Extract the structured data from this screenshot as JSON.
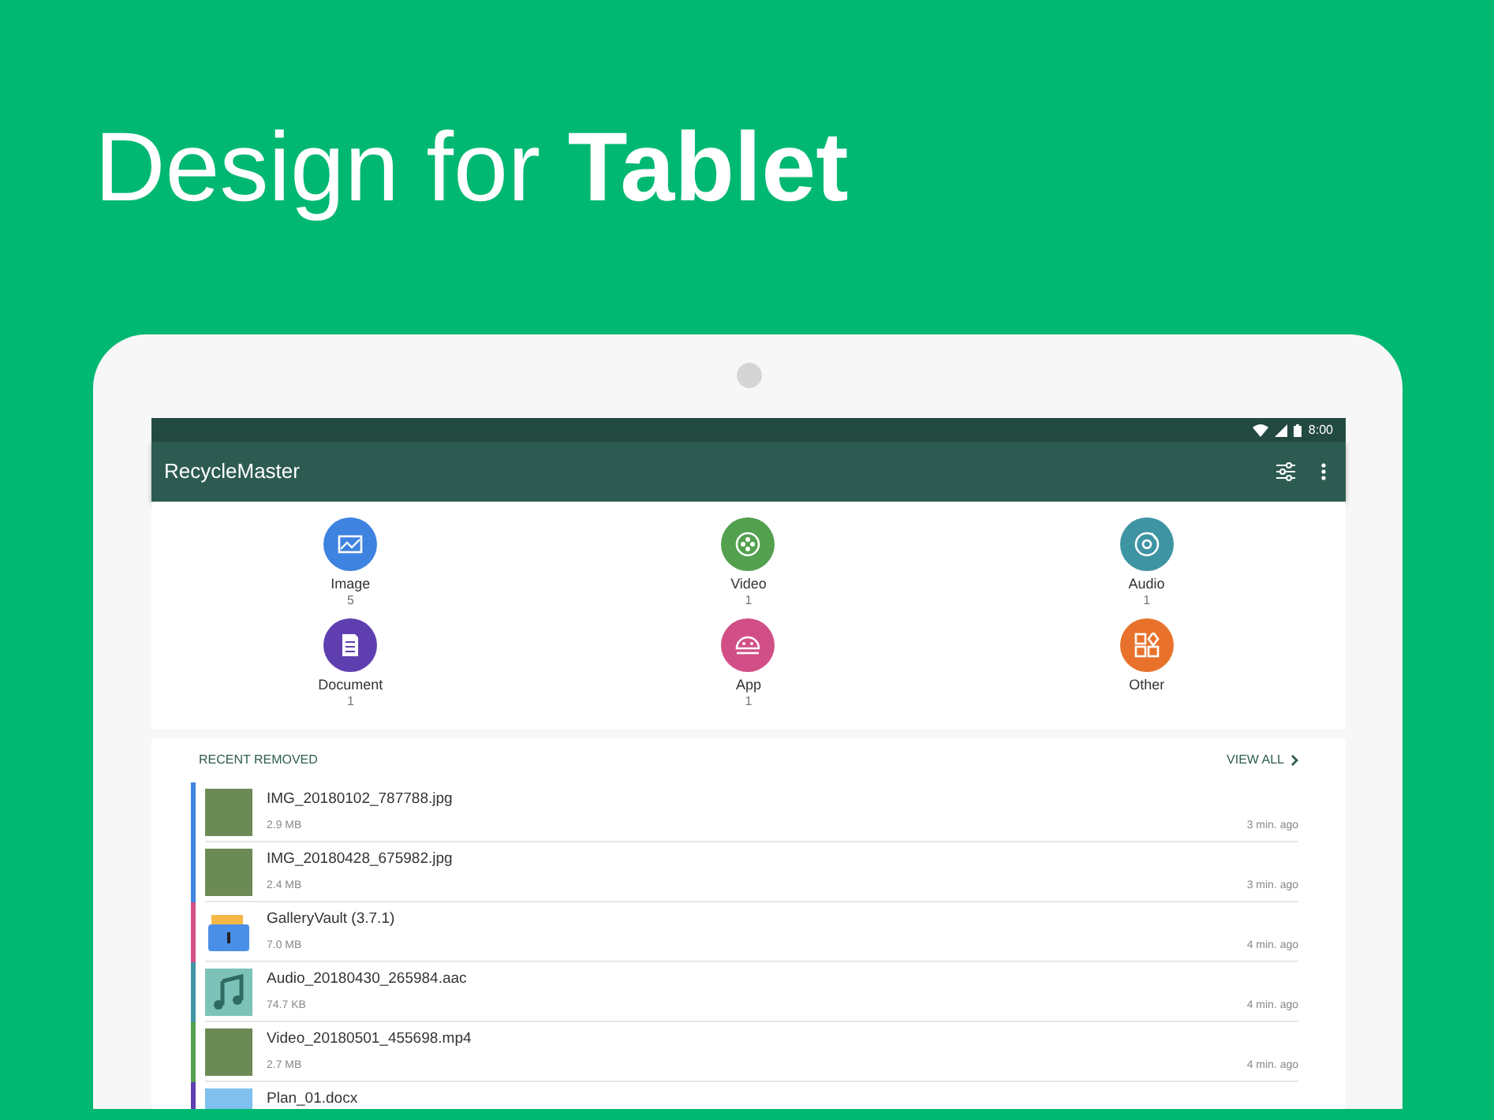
{
  "headline": "Design for **Tablet**",
  "status_bar": {
    "time": "8:00"
  },
  "app_bar": {
    "title": "RecycleMaster"
  },
  "categories": [
    {
      "kind": "image",
      "label": "Image",
      "count": "5",
      "color": "#3e83e0"
    },
    {
      "kind": "video",
      "label": "Video",
      "count": "1",
      "color": "#53a04f"
    },
    {
      "kind": "audio",
      "label": "Audio",
      "count": "1",
      "color": "#3f94a3"
    },
    {
      "kind": "document",
      "label": "Document",
      "count": "1",
      "color": "#5f3fb0"
    },
    {
      "kind": "app",
      "label": "App",
      "count": "1",
      "color": "#d14f86"
    },
    {
      "kind": "other",
      "label": "Other",
      "color": "#e8722b"
    }
  ],
  "recent": {
    "title": "RECENT REMOVED",
    "link": "VIEW ALL",
    "items": [
      {
        "kind": "photo",
        "name": "IMG_20180102_787788.jpg",
        "size": "2.9 MB",
        "time": "3 min. ago",
        "color": "#3e83e0"
      },
      {
        "kind": "photo",
        "name": "IMG_20180428_675982.jpg",
        "size": "2.4 MB",
        "time": "3 min. ago",
        "color": "#3e83e0"
      },
      {
        "kind": "app",
        "name": "GalleryVault (3.7.1)",
        "size": "7.0 MB",
        "time": "4 min. ago",
        "color": "#d14f86"
      },
      {
        "kind": "audio",
        "name": "Audio_20180430_265984.aac",
        "size": "74.7 KB",
        "time": "4 min. ago",
        "color": "#3f94a3"
      },
      {
        "kind": "photo",
        "name": "Video_20180501_455698.mp4",
        "size": "2.7 MB",
        "time": "4 min. ago",
        "color": "#53a04f"
      },
      {
        "kind": "document",
        "name": "Plan_01.docx",
        "color": "#5f3fb0"
      }
    ]
  }
}
